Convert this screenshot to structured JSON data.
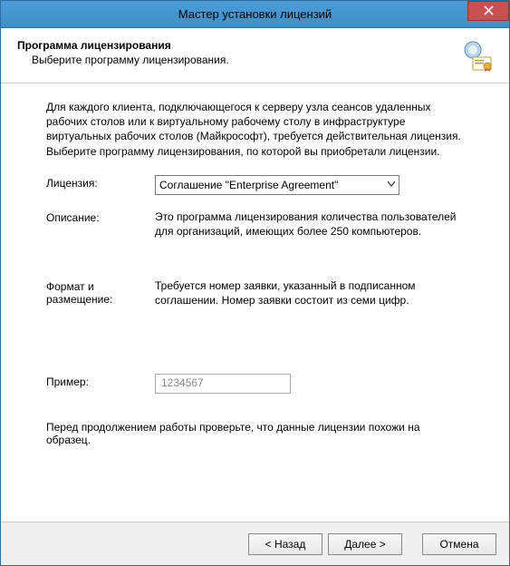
{
  "window": {
    "title": "Мастер установки лицензий"
  },
  "header": {
    "title": "Программа лицензирования",
    "subtitle": "Выберите программу лицензирования."
  },
  "content": {
    "intro": "Для каждого клиента, подключающегося к серверу узла сеансов удаленных рабочих столов или к виртуальному рабочему столу в инфраструктуре виртуальных рабочих столов (Майкрософт), требуется действительная лицензия. Выберите программу лицензирования, по которой вы приобретали лицензии.",
    "license_label": "Лицензия:",
    "license_value": "Соглашение \"Enterprise Agreement\"",
    "description_label": "Описание:",
    "description_value": "Это программа лицензирования количества пользователей для организаций, имеющих более 250 компьютеров.",
    "format_label": "Формат и размещение:",
    "format_value": "Требуется номер заявки, указанный в подписанном соглашении. Номер заявки состоит из семи цифр.",
    "example_label": "Пример:",
    "example_value": "1234567",
    "verify": "Перед продолжением работы проверьте, что данные лицензии похожи на образец."
  },
  "buttons": {
    "back": "< Назад",
    "next": "Далее >",
    "cancel": "Отмена"
  }
}
